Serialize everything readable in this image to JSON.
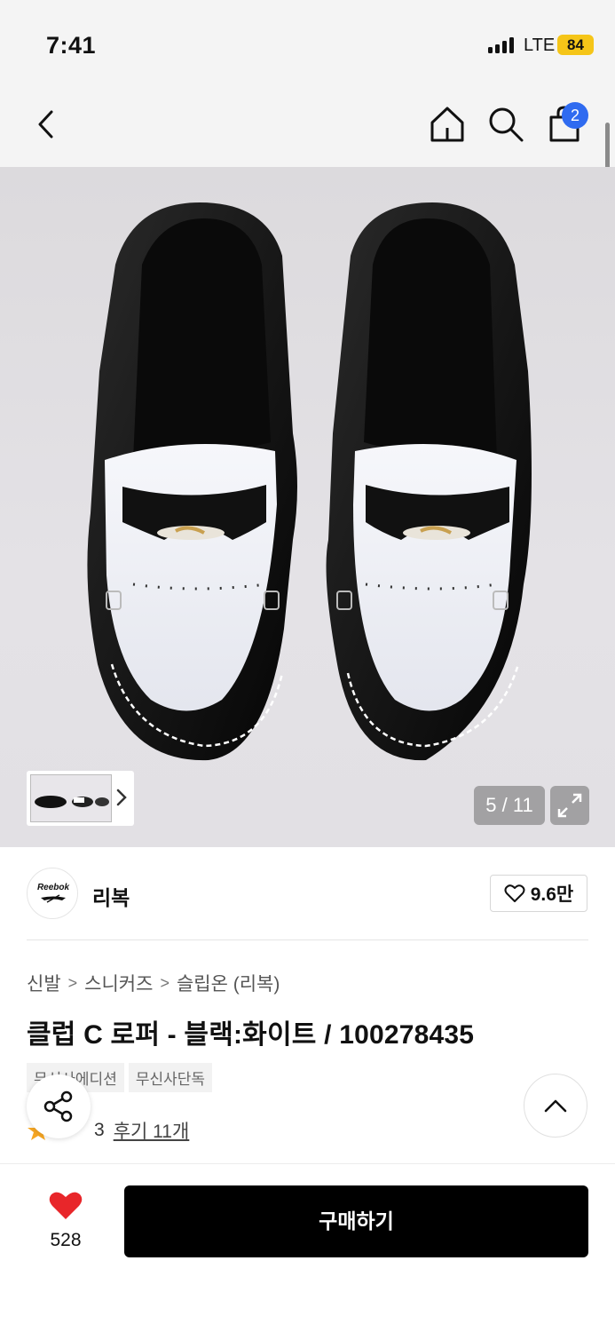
{
  "status_bar": {
    "time": "7:41",
    "network": "LTE",
    "battery": "84"
  },
  "nav": {
    "cart_count": "2",
    "icons": [
      "chevron-left-icon",
      "home-icon",
      "search-icon",
      "shopping-bag-icon"
    ]
  },
  "gallery": {
    "counter": "5 / 11"
  },
  "brand": {
    "logo_text": "Reebok",
    "name": "리복",
    "like_count": "9.6만"
  },
  "breadcrumb": [
    "신발",
    "스니커즈",
    "슬립온 (리복)"
  ],
  "product": {
    "title": "클럽 C 로퍼 - 블랙:화이트 / 100278435",
    "tags": [
      "무신사에디션",
      "무신사단독"
    ],
    "rating_partial": "3",
    "review_label": "후기 11개"
  },
  "bottom_bar": {
    "heart_count": "528",
    "buy_label": "구매하기"
  },
  "colors": {
    "accent_badge": "#2f6bf0",
    "heart": "#e8262a",
    "battery": "#f5c518",
    "star": "#f6a623"
  }
}
